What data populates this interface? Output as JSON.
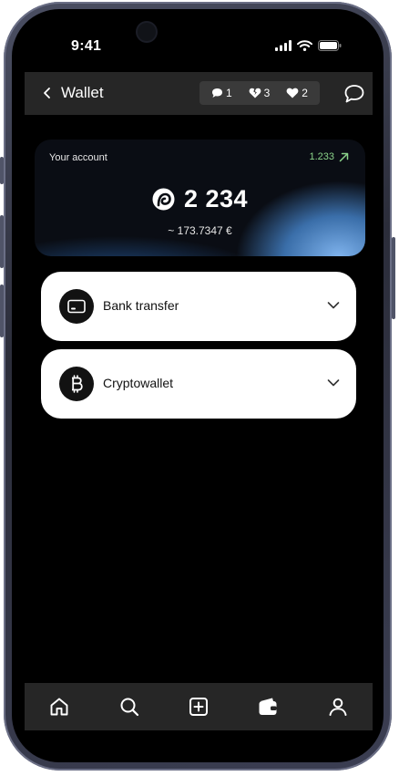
{
  "status_bar": {
    "time": "9:41"
  },
  "header": {
    "back_icon": "chevron-left-icon",
    "title": "Wallet",
    "counts": [
      {
        "icon": "comment-icon",
        "value": "1"
      },
      {
        "icon": "broken-heart-icon",
        "value": "3"
      },
      {
        "icon": "heart-icon",
        "value": "2"
      }
    ],
    "chat_icon": "chat-bubble-icon"
  },
  "account": {
    "label": "Your account",
    "trend_value": "1.233",
    "trend_icon": "arrow-up-right-icon",
    "balance": "2 234",
    "eur_value": "~ 173.7347 €",
    "trend_color": "#8bd38a"
  },
  "methods": [
    {
      "label": "Bank transfer",
      "icon": "card-icon"
    },
    {
      "label": "Cryptowallet",
      "icon": "bitcoin-icon"
    }
  ],
  "tabbar": {
    "items": [
      {
        "icon": "home-icon"
      },
      {
        "icon": "search-icon"
      },
      {
        "icon": "add-post-icon"
      },
      {
        "icon": "wallet-icon"
      },
      {
        "icon": "profile-icon"
      }
    ]
  }
}
